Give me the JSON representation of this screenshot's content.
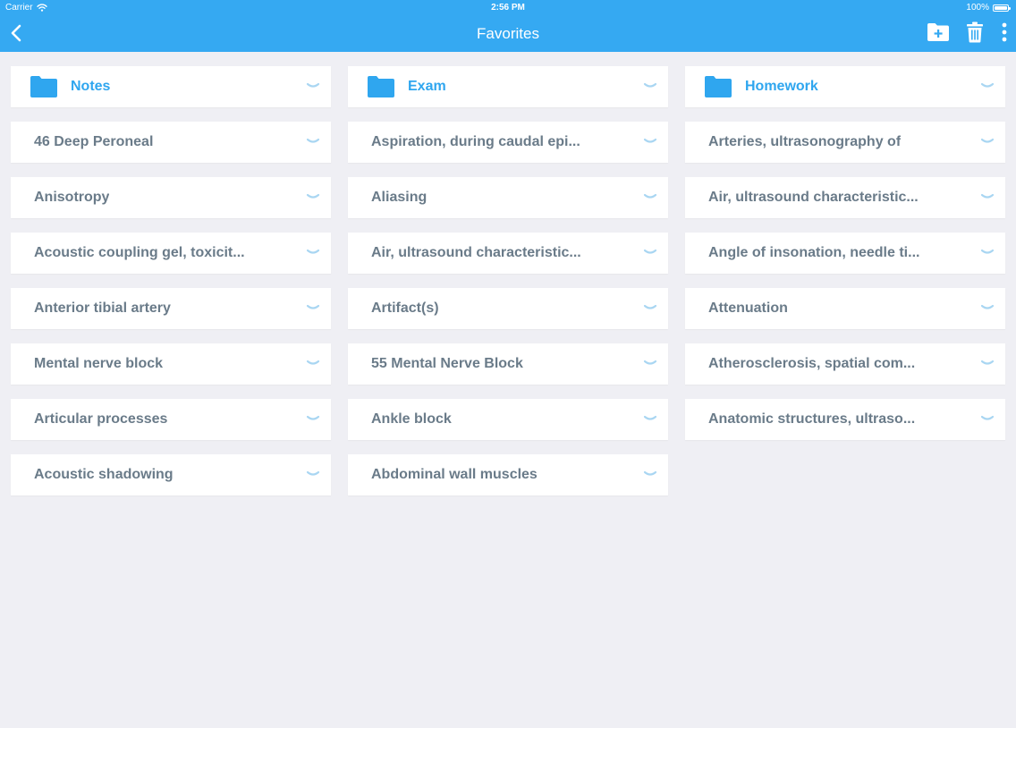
{
  "status_bar": {
    "carrier": "Carrier",
    "time": "2:56 PM",
    "battery": "100%"
  },
  "nav": {
    "title": "Favorites",
    "back_icon": "chevron-left-icon",
    "actions": [
      "new-folder-icon",
      "trash-icon",
      "more-vertical-icon"
    ]
  },
  "colors": {
    "accent": "#35a9f2",
    "folder": "#2fa6ef",
    "item_text": "#6a7b89",
    "background": "#efeff4",
    "chevron": "#a9d6f2"
  },
  "folders": [
    {
      "label": "Notes"
    },
    {
      "label": "Exam"
    },
    {
      "label": "Homework"
    }
  ],
  "items": [
    [
      "46 Deep Peroneal",
      "Aspiration, during caudal epi...",
      "Arteries, ultrasonography of"
    ],
    [
      "Anisotropy",
      "Aliasing",
      "Air, ultrasound characteristic..."
    ],
    [
      "Acoustic coupling gel, toxicit...",
      "Air, ultrasound characteristic...",
      "Angle of insonation, needle ti..."
    ],
    [
      "Anterior tibial artery",
      "Artifact(s)",
      "Attenuation"
    ],
    [
      "Mental nerve block",
      "55 Mental Nerve Block",
      "Atherosclerosis, spatial com..."
    ],
    [
      "Articular processes",
      "Ankle block",
      "Anatomic structures, ultraso..."
    ],
    [
      "Acoustic shadowing",
      "Abdominal wall muscles",
      null
    ]
  ]
}
